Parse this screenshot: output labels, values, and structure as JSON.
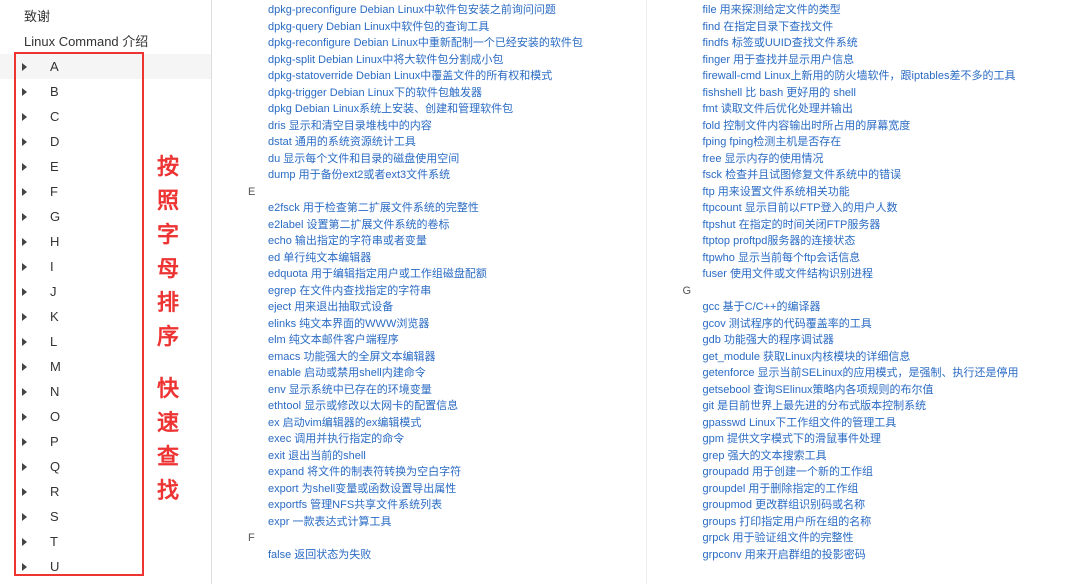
{
  "sidebar": {
    "top0": "致谢",
    "top1": "Linux Command 介绍",
    "letters": [
      "A",
      "B",
      "C",
      "D",
      "E",
      "F",
      "G",
      "H",
      "I",
      "J",
      "K",
      "L",
      "M",
      "N",
      "O",
      "P",
      "Q",
      "R",
      "S",
      "T",
      "U"
    ],
    "active": "A"
  },
  "annotation": {
    "line1": "按照字母排序",
    "line2": "快速查找"
  },
  "col1": {
    "groupD": [
      "dpkg-preconfigure Debian Linux中软件包安装之前询问问题",
      "dpkg-query Debian Linux中软件包的查询工具",
      "dpkg-reconfigure Debian Linux中重新配制一个已经安装的软件包",
      "dpkg-split Debian Linux中将大软件包分割成小包",
      "dpkg-statoverride Debian Linux中覆盖文件的所有权和模式",
      "dpkg-trigger Debian Linux下的软件包触发器",
      "dpkg Debian Linux系统上安装、创建和管理软件包",
      "dris 显示和清空目录堆栈中的内容",
      "dstat 通用的系统资源统计工具",
      "du 显示每个文件和目录的磁盘使用空间",
      "dump 用于备份ext2或者ext3文件系统"
    ],
    "letterE": "E",
    "groupE": [
      "e2fsck 用于检查第二扩展文件系统的完整性",
      "e2label 设置第二扩展文件系统的卷标",
      "echo 输出指定的字符串或者变量",
      "ed 单行纯文本编辑器",
      "edquota 用于编辑指定用户或工作组磁盘配额",
      "egrep 在文件内查找指定的字符串",
      "eject 用来退出抽取式设备",
      "elinks 纯文本界面的WWW浏览器",
      "elm 纯文本邮件客户端程序",
      "emacs 功能强大的全屏文本编辑器",
      "enable 启动或禁用shell内建命令",
      "env 显示系统中已存在的环境变量",
      "ethtool 显示或修改以太网卡的配置信息",
      "ex 启动vim编辑器的ex编辑模式",
      "exec 调用并执行指定的命令",
      "exit 退出当前的shell",
      "expand 将文件的制表符转换为空白字符",
      "export 为shell变量或函数设置导出属性",
      "exportfs 管理NFS共享文件系统列表",
      "expr 一款表达式计算工具"
    ],
    "letterF": "F",
    "groupF": [
      "false 返回状态为失败"
    ]
  },
  "col2": {
    "groupF": [
      "file 用来探测给定文件的类型",
      "find 在指定目录下查找文件",
      "findfs 标签或UUID查找文件系统",
      "finger 用于查找并显示用户信息",
      "firewall-cmd Linux上新用的防火墙软件，跟iptables差不多的工具",
      "fishshell 比 bash 更好用的 shell",
      "fmt 读取文件后优化处理并输出",
      "fold 控制文件内容输出时所占用的屏幕宽度",
      "fping fping检测主机是否存在",
      "free 显示内存的使用情况",
      "fsck 检查并且试图修复文件系统中的错误",
      "ftp 用来设置文件系统相关功能",
      "ftpcount 显示目前以FTP登入的用户人数",
      "ftpshut 在指定的时间关闭FTP服务器",
      "ftptop proftpd服务器的连接状态",
      "ftpwho 显示当前每个ftp会话信息",
      "fuser 使用文件或文件结构识别进程"
    ],
    "letterG": "G",
    "groupG": [
      "gcc 基于C/C++的编译器",
      "gcov 测试程序的代码覆盖率的工具",
      "gdb 功能强大的程序调试器",
      "get_module 获取Linux内核模块的详细信息",
      "getenforce 显示当前SELinux的应用模式，是强制、执行还是停用",
      "getsebool 查询SElinux策略内各项规则的布尔值",
      "git 是目前世界上最先进的分布式版本控制系统",
      "gpasswd Linux下工作组文件的管理工具",
      "gpm 提供文字模式下的滑鼠事件处理",
      "grep 强大的文本搜索工具",
      "groupadd 用于创建一个新的工作组",
      "groupdel 用于删除指定的工作组",
      "groupmod 更改群组识别码或名称",
      "groups 打印指定用户所在组的名称",
      "grpck 用于验证组文件的完整性",
      "grpconv 用来开启群组的投影密码"
    ]
  }
}
